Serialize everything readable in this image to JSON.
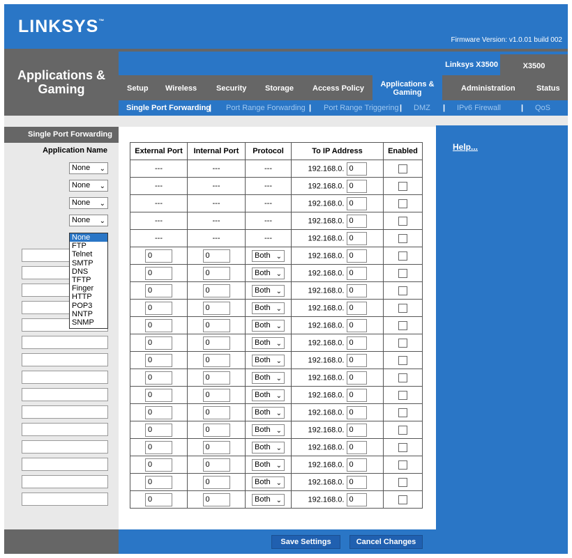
{
  "header": {
    "logo": "LINKSYS",
    "logo_mark": "™",
    "firmware": "Firmware Version: v1.0.01 build 002",
    "model_name": "Linksys X3500",
    "model_short": "X3500"
  },
  "section_title": "Applications & Gaming",
  "tabs": [
    "Setup",
    "Wireless",
    "Security",
    "Storage",
    "Access Policy",
    "Applications & Gaming",
    "Administration",
    "Status"
  ],
  "subnav": [
    "Single Port Forwarding",
    "Port Range Forwarding",
    "Port Range Triggering",
    "DMZ",
    "IPv6 Firewall",
    "QoS"
  ],
  "left": {
    "title": "Single Port Forwarding",
    "app_name_label": "Application Name",
    "app_selects": [
      "None",
      "None",
      "None",
      "None",
      "None"
    ]
  },
  "dropdown_options": [
    "None",
    "FTP",
    "Telnet",
    "SMTP",
    "DNS",
    "TFTP",
    "Finger",
    "HTTP",
    "POP3",
    "NNTP",
    "SNMP"
  ],
  "table": {
    "headers": [
      "External Port",
      "Internal Port",
      "Protocol",
      "To IP Address",
      "Enabled"
    ],
    "ip_prefix": "192.168.0.",
    "preset_rows": [
      {
        "ext": "---",
        "int": "---",
        "proto": "---",
        "ip": "0"
      },
      {
        "ext": "---",
        "int": "---",
        "proto": "---",
        "ip": "0"
      },
      {
        "ext": "---",
        "int": "---",
        "proto": "---",
        "ip": "0"
      },
      {
        "ext": "---",
        "int": "---",
        "proto": "---",
        "ip": "0"
      },
      {
        "ext": "---",
        "int": "---",
        "proto": "---",
        "ip": "0"
      }
    ],
    "custom_rows": [
      {
        "ext": "0",
        "int": "0",
        "proto": "Both",
        "ip": "0"
      },
      {
        "ext": "0",
        "int": "0",
        "proto": "Both",
        "ip": "0"
      },
      {
        "ext": "0",
        "int": "0",
        "proto": "Both",
        "ip": "0"
      },
      {
        "ext": "0",
        "int": "0",
        "proto": "Both",
        "ip": "0"
      },
      {
        "ext": "0",
        "int": "0",
        "proto": "Both",
        "ip": "0"
      },
      {
        "ext": "0",
        "int": "0",
        "proto": "Both",
        "ip": "0"
      },
      {
        "ext": "0",
        "int": "0",
        "proto": "Both",
        "ip": "0"
      },
      {
        "ext": "0",
        "int": "0",
        "proto": "Both",
        "ip": "0"
      },
      {
        "ext": "0",
        "int": "0",
        "proto": "Both",
        "ip": "0"
      },
      {
        "ext": "0",
        "int": "0",
        "proto": "Both",
        "ip": "0"
      },
      {
        "ext": "0",
        "int": "0",
        "proto": "Both",
        "ip": "0"
      },
      {
        "ext": "0",
        "int": "0",
        "proto": "Both",
        "ip": "0"
      },
      {
        "ext": "0",
        "int": "0",
        "proto": "Both",
        "ip": "0"
      },
      {
        "ext": "0",
        "int": "0",
        "proto": "Both",
        "ip": "0"
      },
      {
        "ext": "0",
        "int": "0",
        "proto": "Both",
        "ip": "0"
      }
    ]
  },
  "help_link": "Help...",
  "buttons": {
    "save": "Save Settings",
    "cancel": "Cancel Changes"
  },
  "colors": {
    "brand_blue": "#2a76c6",
    "gray": "#666666",
    "panel_gray": "#e9e9e9"
  }
}
